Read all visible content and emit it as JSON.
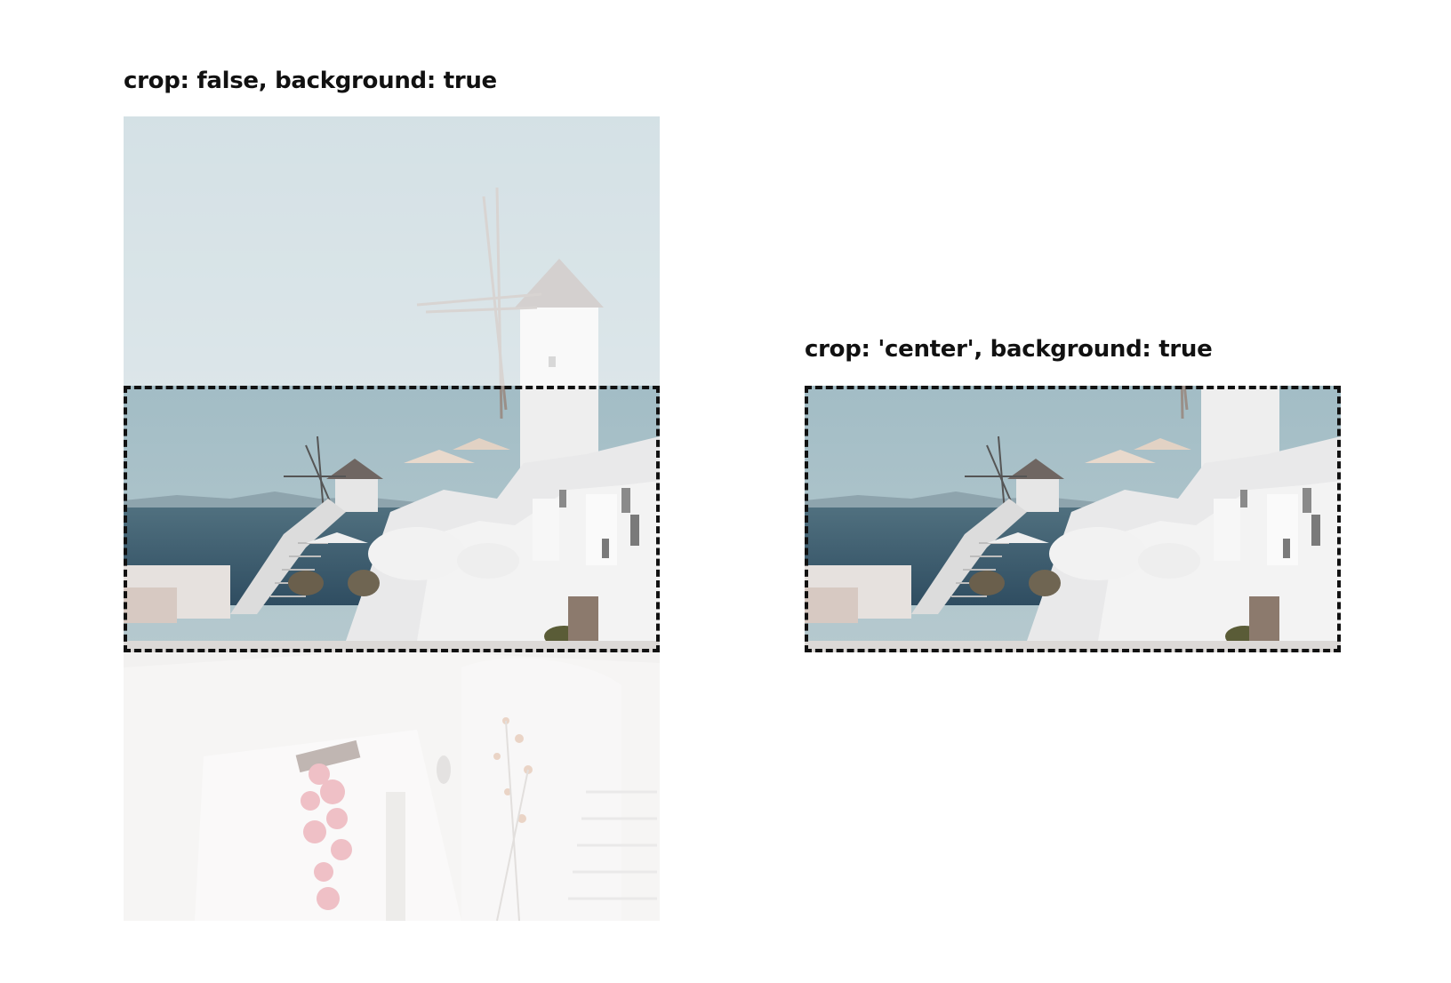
{
  "demos": {
    "left": {
      "title": "crop: false, background: true"
    },
    "right": {
      "title": "crop: 'center', background: true"
    }
  },
  "photo": {
    "description_name": "santorini-windmill-photo",
    "colors": {
      "sky": "#a9bfc6",
      "sea": "#3f5f73",
      "white_building": "#ededed",
      "roof": "#8f8580",
      "flowers": "#d45a6a"
    }
  }
}
